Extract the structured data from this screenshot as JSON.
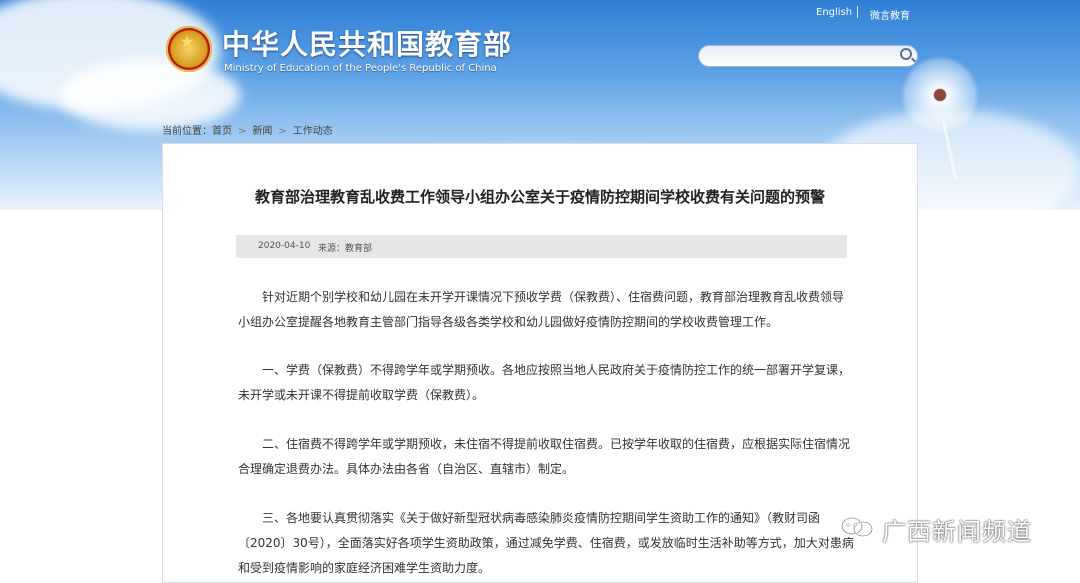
{
  "header": {
    "title": "中华人民共和国教育部",
    "subtitle": "Ministry of Education of the People's Republic of China",
    "links": {
      "english": "English",
      "wechat": "微言教育"
    },
    "search": {
      "placeholder": ""
    }
  },
  "breadcrumb": {
    "label": "当前位置：",
    "items": [
      "首页",
      "新闻",
      "工作动态"
    ]
  },
  "article": {
    "title": "教育部治理教育乱收费工作领导小组办公室关于疫情防控期间学校收费有关问题的预警",
    "date": "2020-04-10",
    "source_label": "来源：",
    "source": "教育部",
    "paragraphs": [
      "针对近期个别学校和幼儿园在未开学开课情况下预收学费（保教费）、住宿费问题，教育部治理教育乱收费领导小组办公室提醒各地教育主管部门指导各级各类学校和幼儿园做好疫情防控期间的学校收费管理工作。",
      "一、学费（保教费）不得跨学年或学期预收。各地应按照当地人民政府关于疫情防控工作的统一部署开学复课，未开学或未开课不得提前收取学费（保教费）。",
      "二、住宿费不得跨学年或学期预收，未住宿不得提前收取住宿费。已按学年收取的住宿费，应根据实际住宿情况合理确定退费办法。具体办法由各省（自治区、直辖市）制定。",
      "三、各地要认真贯彻落实《关于做好新型冠状病毒感染肺炎疫情防控期间学生资助工作的通知》（教财司函〔2020〕30号），全面落实好各项学生资助政策，通过减免学费、住宿费，或发放临时生活补助等方式，加大对患病和受到疫情影响的家庭经济困难学生资助力度。"
    ]
  },
  "watermark": {
    "text": "广西新闻频道",
    "icon": "wechat-icon"
  },
  "colors": {
    "sky": "#5ea2e6",
    "meta_bar": "#e6e6e6"
  }
}
